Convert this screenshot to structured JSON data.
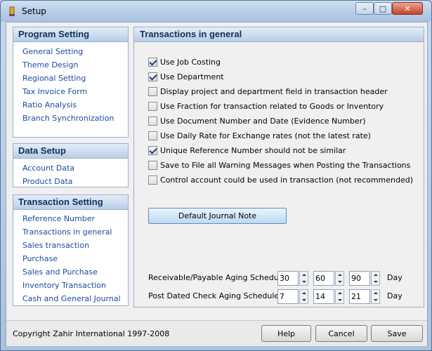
{
  "window": {
    "title": "Setup"
  },
  "nav_sections": [
    {
      "title": "Program Setting",
      "items": [
        "General Setting",
        "Theme Design",
        "Regional Setting",
        "Tax Invoice Form",
        "Ratio Analysis",
        "Branch Synchronization"
      ]
    },
    {
      "title": "Data Setup",
      "items": [
        "Account Data",
        "Product Data"
      ]
    },
    {
      "title": "Transaction Setting",
      "items": [
        "Reference Number",
        "Transactions in general",
        "Sales transaction",
        "Purchase",
        "Sales and Purchase",
        "Inventory Transaction",
        "Cash and General Journal"
      ]
    }
  ],
  "panel": {
    "title": "Transactions in general",
    "options": [
      {
        "label": "Use Job Costing",
        "checked": true
      },
      {
        "label": "Use Department",
        "checked": true
      },
      {
        "label": "Display project and department field in transaction header",
        "checked": false
      },
      {
        "label": "Use Fraction for transaction related to Goods or Inventory",
        "checked": false
      },
      {
        "label": "Use Document Number and Date (Evidence Number)",
        "checked": false
      },
      {
        "label": "Use Daily Rate for Exchange rates (not the latest  rate)",
        "checked": false
      },
      {
        "label": "Unique Reference Number should not be similar",
        "checked": true
      },
      {
        "label": "Save to File all Warning Messages when Posting the Transactions",
        "checked": false
      },
      {
        "label": "Control account could be used in transaction (not recommended)",
        "checked": false
      }
    ],
    "journal_button": "Default Journal Note",
    "aging": [
      {
        "label": "Receivable/Payable Aging Schedule:",
        "values": [
          "30",
          "60",
          "90"
        ],
        "unit": "Day"
      },
      {
        "label": "Post Dated Check Aging Schedule:",
        "values": [
          "7",
          "14",
          "21"
        ],
        "unit": "Day"
      }
    ]
  },
  "footer": {
    "copyright": "Copyright Zahir International 1997-2008",
    "help": "Help",
    "cancel": "Cancel",
    "save": "Save"
  }
}
